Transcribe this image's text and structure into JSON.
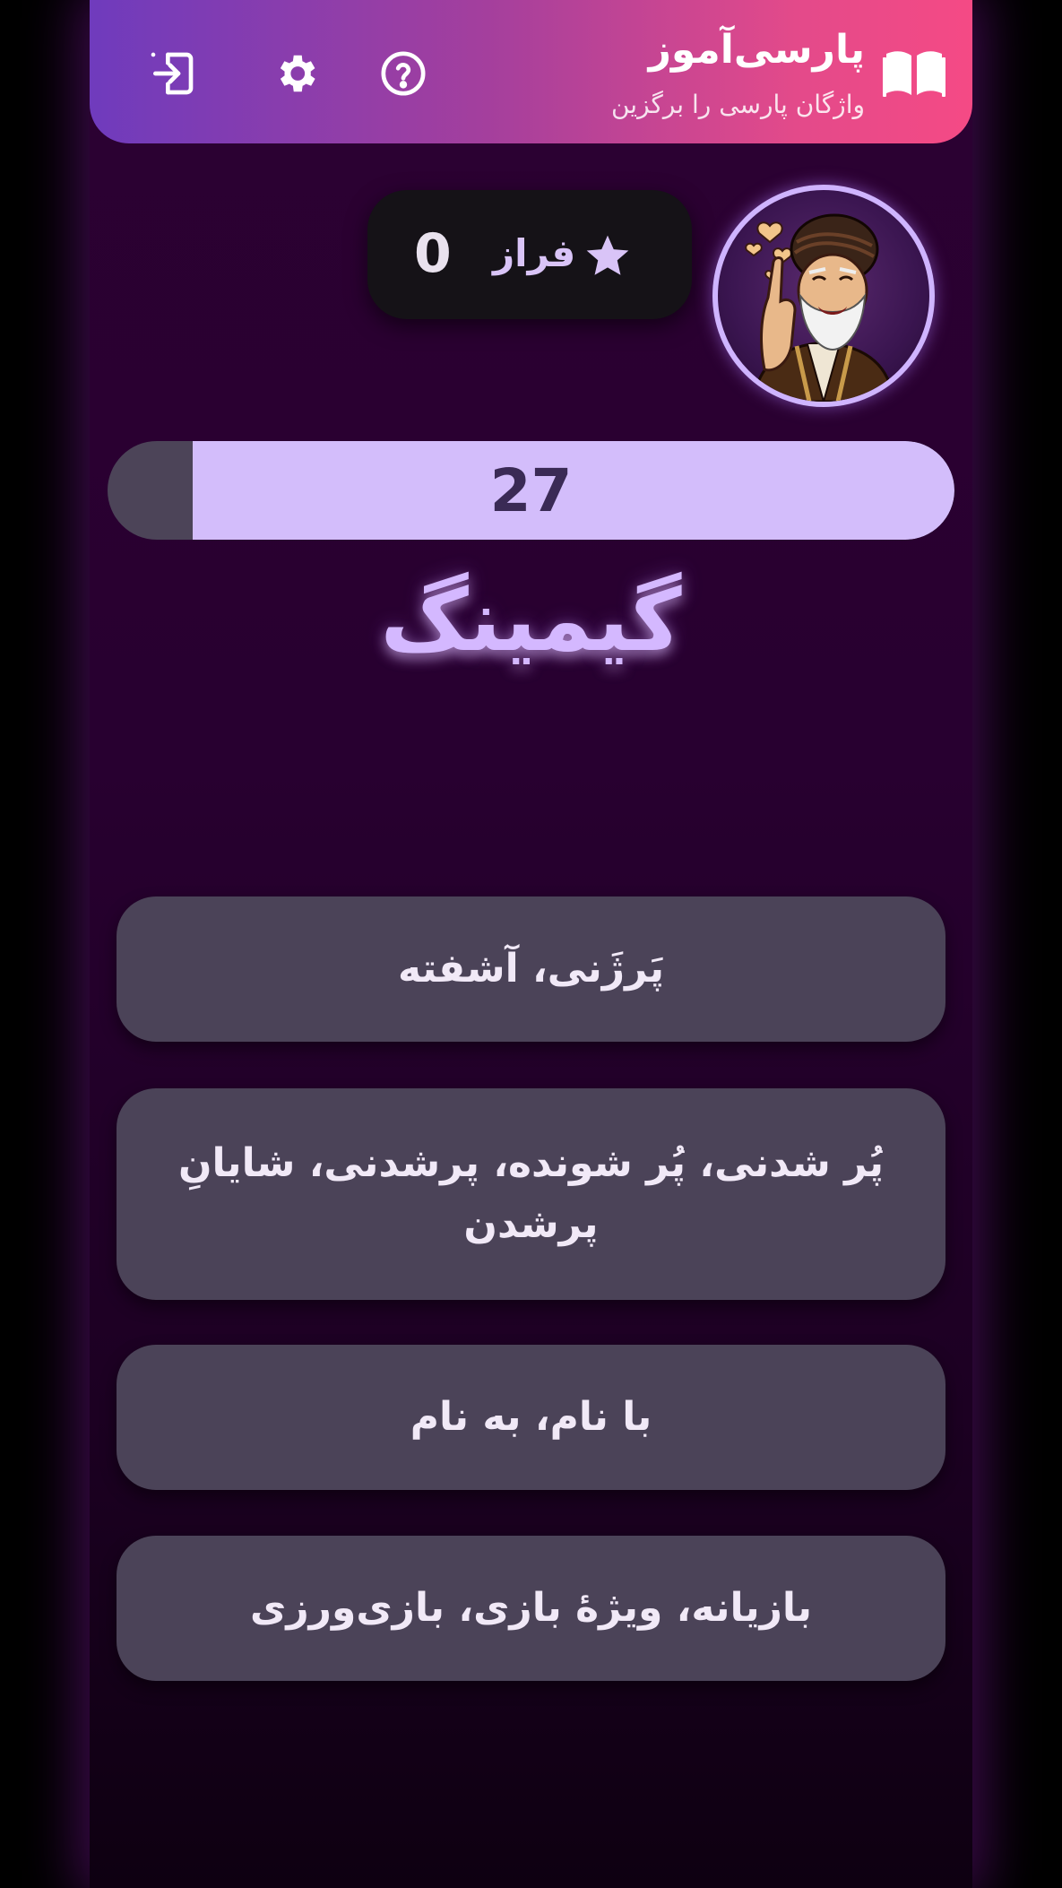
{
  "header": {
    "title": "پارسی‌آموز",
    "subtitle": "واژگان پارسی را برگزین",
    "icons": [
      "book-icon",
      "help-icon",
      "settings-icon",
      "exit-icon"
    ]
  },
  "player": {
    "name": "فراز",
    "score": "0",
    "avatar": "bearded-man-sticker"
  },
  "timer": {
    "value": "27",
    "remaining_fraction": 0.9
  },
  "question": {
    "word": "گیمینگ"
  },
  "options": [
    "پَرژَنی، آشفته",
    "پُر شدنی، پُر شونده، پرشدنی، شایانِ پرشدن",
    "با نام، به نام",
    "بازیانه، ویژۀ بازی، بازی‌ورزی"
  ],
  "colors": {
    "header_gradient_start": "#6f3bbd",
    "header_gradient_end": "#f54a85",
    "accent": "#d3bdfb",
    "option_bg": "#4b4358",
    "background": "#2c0132"
  }
}
